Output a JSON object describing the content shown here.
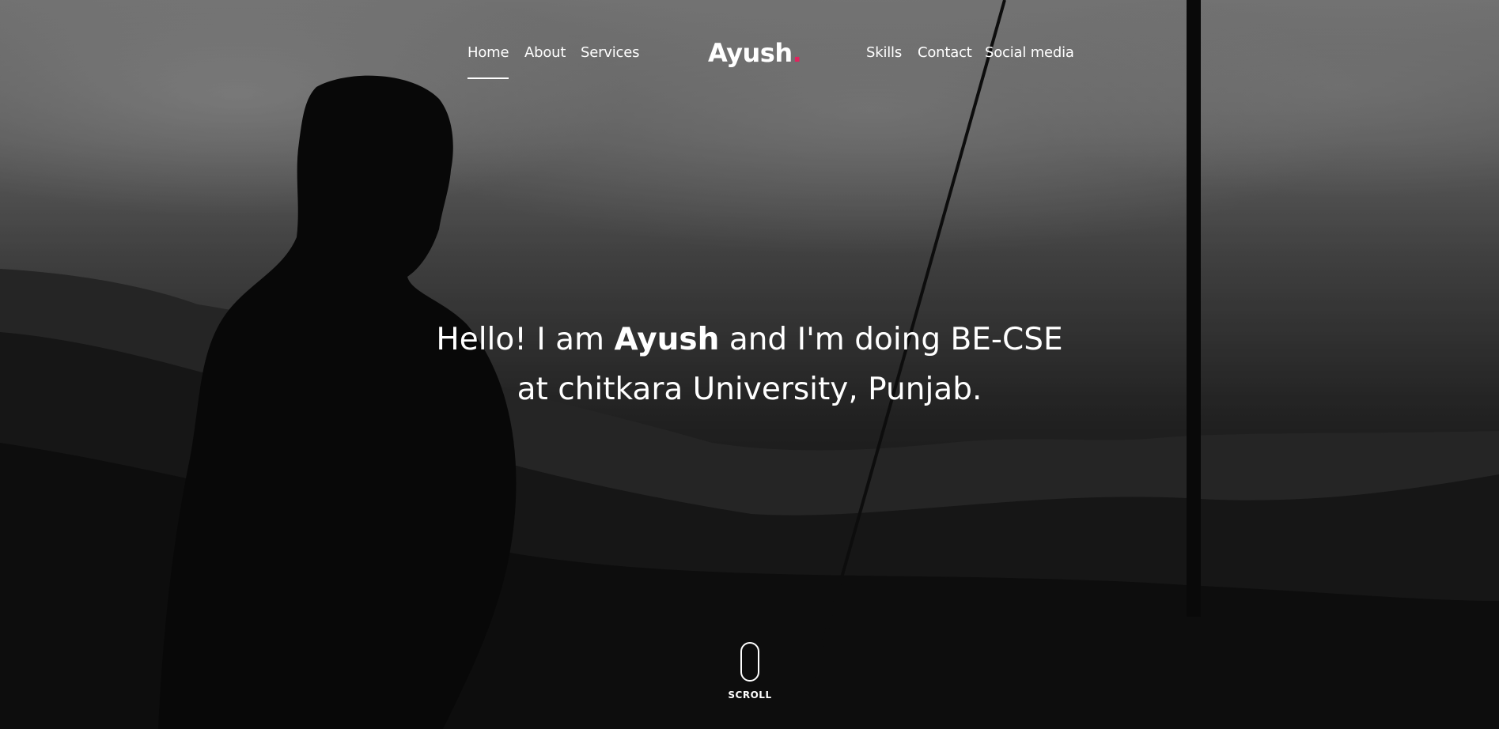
{
  "brand": {
    "name": "Ayush",
    "dot": ".",
    "accent_color": "#e0245e"
  },
  "nav": {
    "left": [
      {
        "label": "Home",
        "active": true
      },
      {
        "label": "About",
        "active": false
      },
      {
        "label": "Services",
        "active": false
      }
    ],
    "right": [
      {
        "label": "Skills",
        "active": false
      },
      {
        "label": "Contact",
        "active": false
      },
      {
        "label": "Social media",
        "active": false
      }
    ]
  },
  "intro": {
    "line1_pre": "Hello! I am ",
    "line1_name": "Ayush",
    "line1_post": " and I'm doing BE-CSE",
    "line2": "at chitkara University, Punjab."
  },
  "scroll": {
    "label": "SCROLL",
    "icon": "mouse-icon"
  }
}
